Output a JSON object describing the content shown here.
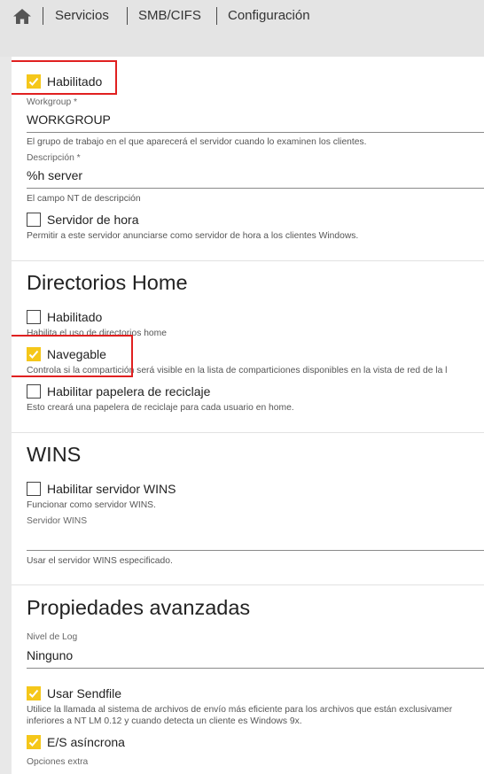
{
  "breadcrumb": {
    "home_icon": "home-icon",
    "items": [
      "Servicios",
      "SMB/CIFS",
      "Configuración"
    ]
  },
  "general": {
    "enabled": {
      "label": "Habilitado",
      "checked": true
    },
    "workgroup": {
      "label": "Workgroup *",
      "value": "WORKGROUP",
      "hint": "El grupo de trabajo en el que aparecerá el servidor cuando lo examinen los clientes."
    },
    "description": {
      "label": "Descripción *",
      "value": "%h server",
      "hint": "El campo NT de descripción"
    },
    "time_server": {
      "label": "Servidor de hora",
      "checked": false,
      "hint": "Permitir a este servidor anunciarse como servidor de hora a los clientes Windows."
    }
  },
  "home_dirs": {
    "title": "Directorios Home",
    "enabled": {
      "label": "Habilitado",
      "checked": false,
      "hint": "Habilita el uso de directorios home"
    },
    "browseable": {
      "label": "Navegable",
      "checked": true,
      "hint": "Controla si la compartición será visible en la lista de comparticiones disponibles en la vista de red de la l"
    },
    "recycle": {
      "label": "Habilitar papelera de reciclaje",
      "checked": false,
      "hint": "Esto creará una papelera de reciclaje para cada usuario en home."
    }
  },
  "wins": {
    "title": "WINS",
    "enable": {
      "label": "Habilitar servidor WINS",
      "checked": false,
      "hint": "Funcionar como servidor WINS."
    },
    "server": {
      "label": "Servidor WINS",
      "value": "",
      "hint": "Usar el servidor WINS especificado."
    }
  },
  "advanced": {
    "title": "Propiedades avanzadas",
    "log_level": {
      "label": "Nivel de Log",
      "value": "Ninguno"
    },
    "sendfile": {
      "label": "Usar Sendfile",
      "checked": true,
      "hint1": "Utilice la llamada al sistema de archivos de envío más eficiente para los archivos que están exclusivamer",
      "hint2": "inferiores a NT LM 0.12 y cuando detecta un cliente es Windows 9x."
    },
    "async_io": {
      "label": "E/S asíncrona",
      "checked": true
    },
    "extra_options": {
      "label": "Opciones extra"
    }
  },
  "colors": {
    "accent": "#f5c71a",
    "highlight": "#e02020"
  }
}
